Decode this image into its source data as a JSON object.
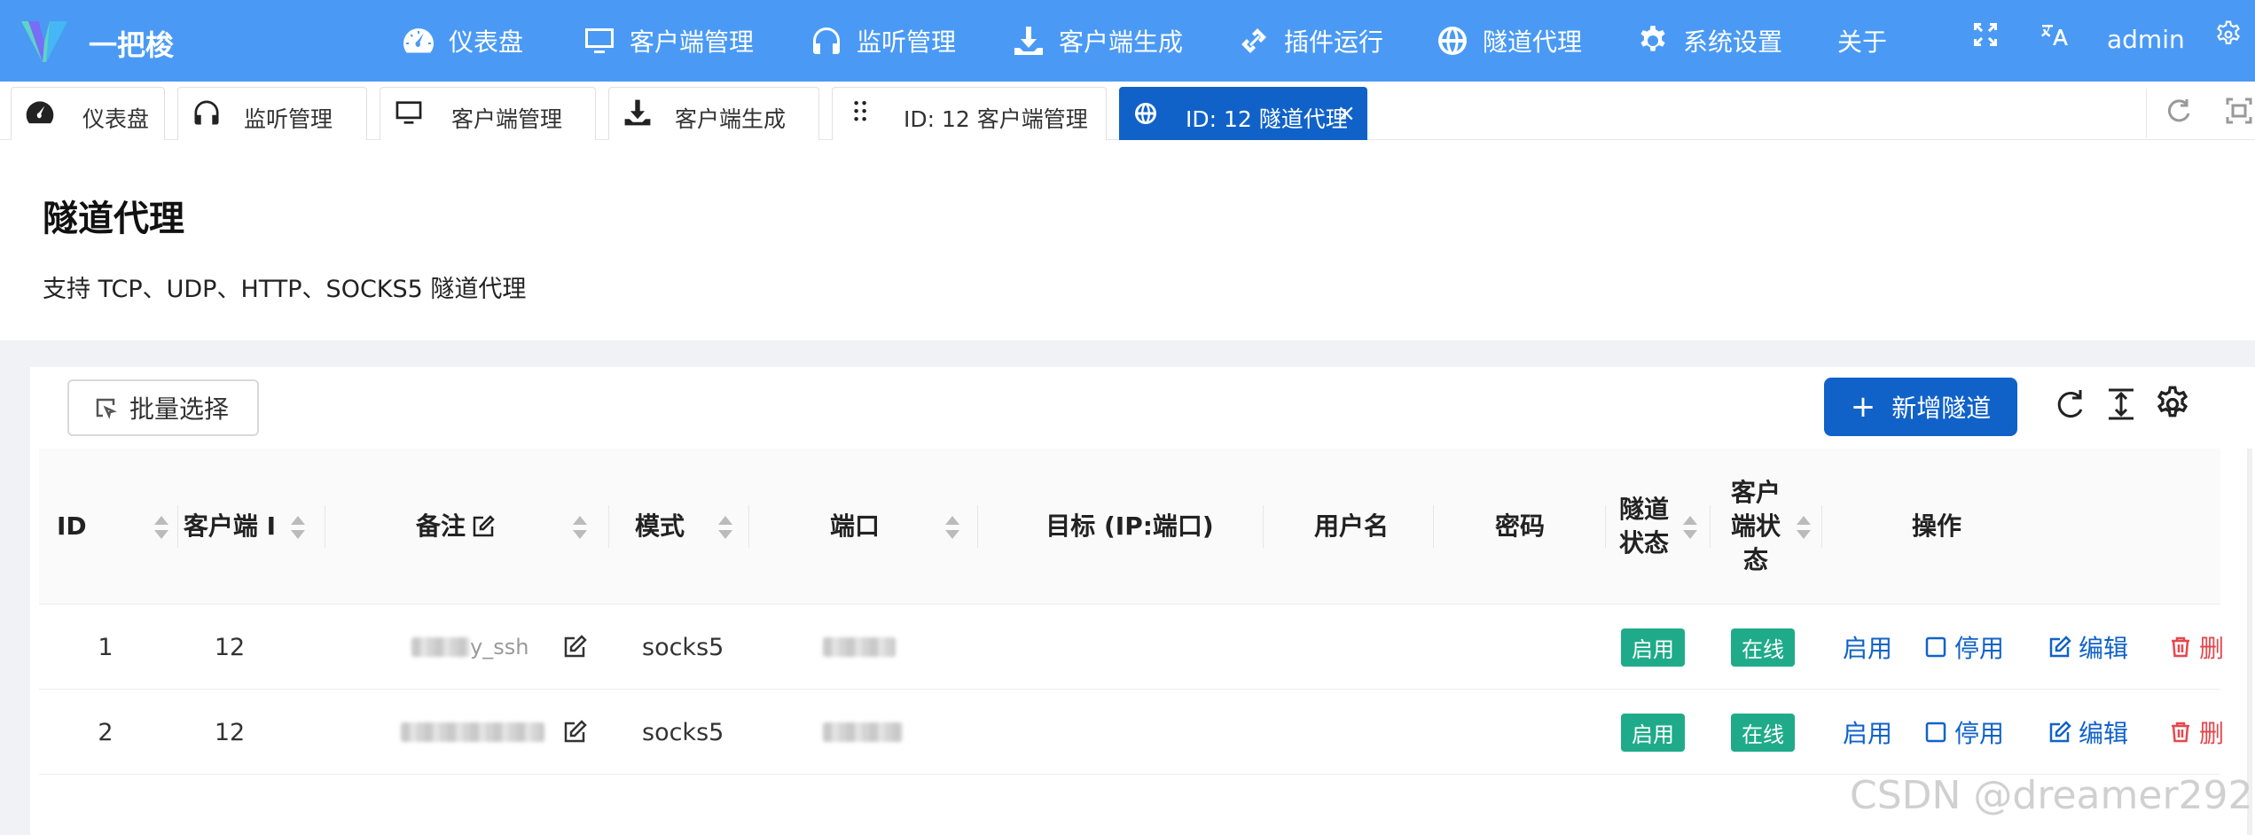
{
  "app": {
    "name": "一把梭"
  },
  "nav": {
    "items": [
      {
        "label": "仪表盘",
        "icon": "dashboard-icon"
      },
      {
        "label": "客户端管理",
        "icon": "monitor-icon"
      },
      {
        "label": "监听管理",
        "icon": "headphones-icon"
      },
      {
        "label": "客户端生成",
        "icon": "download-icon"
      },
      {
        "label": "插件运行",
        "icon": "plugin-link-icon"
      },
      {
        "label": "隧道代理",
        "icon": "globe-icon"
      },
      {
        "label": "系统设置",
        "icon": "gear-icon"
      },
      {
        "label": "关于",
        "icon": ""
      }
    ],
    "user": "admin"
  },
  "tabs": [
    {
      "label": "仪表盘",
      "icon": "dashboard-icon"
    },
    {
      "label": "监听管理",
      "icon": "headphones-icon"
    },
    {
      "label": "客户端管理",
      "icon": "monitor-icon"
    },
    {
      "label": "客户端生成",
      "icon": "download-icon"
    },
    {
      "label": "ID: 12 客户端管理",
      "icon": "drag-dots-icon"
    },
    {
      "label": "ID: 12 隧道代理",
      "icon": "globe-icon",
      "active": true
    }
  ],
  "page": {
    "title": "隧道代理",
    "description": "支持 TCP、UDP、HTTP、SOCKS5 隧道代理"
  },
  "toolbar": {
    "batch_select": "批量选择",
    "add_tunnel": "新增隧道"
  },
  "table": {
    "headers": {
      "id": "ID",
      "client_id": "客户端 I",
      "remark": "备注",
      "mode": "模式",
      "port": "端口",
      "target": "目标 (IP:端口)",
      "username": "用户名",
      "password": "密码",
      "tunnel_status": "隧道状态",
      "client_status": "客户端状态",
      "actions": "操作"
    },
    "rows": [
      {
        "id": "1",
        "client_id": "12",
        "remark_visible": "y_ssh",
        "mode": "socks5",
        "tunnel_status": "启用",
        "client_status": "在线",
        "act_enable": "启用",
        "act_disable": "停用",
        "act_edit": "编辑",
        "act_delete": "删"
      },
      {
        "id": "2",
        "client_id": "12",
        "remark_visible": "",
        "mode": "socks5",
        "tunnel_status": "启用",
        "client_status": "在线",
        "act_enable": "启用",
        "act_disable": "停用",
        "act_edit": "编辑",
        "act_delete": "删"
      }
    ]
  },
  "colors": {
    "nav_bg": "#4a9af5",
    "primary": "#1062c9",
    "success": "#1fab89",
    "danger": "#e5484d"
  },
  "watermark": "CSDN @dreamer292"
}
